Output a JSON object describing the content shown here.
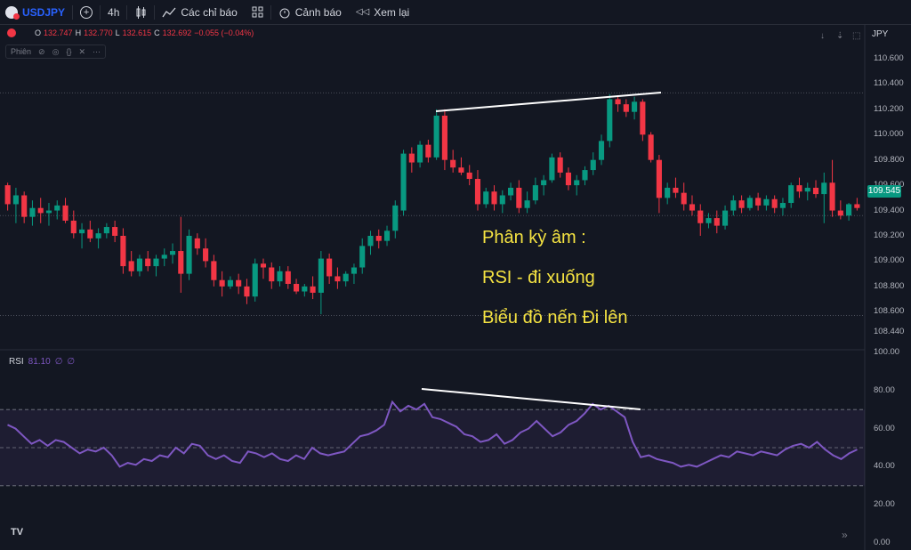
{
  "toolbar": {
    "symbol": "USDJPY",
    "add_icon": "+",
    "interval": "4h",
    "indicators_label": "Các chỉ báo",
    "alerts_label": "Cảnh báo",
    "replay_label": "Xem lại"
  },
  "legend": {
    "o_label": "O",
    "o": "132.747",
    "h_label": "H",
    "h": "132.770",
    "l_label": "L",
    "l": "132.615",
    "c_label": "C",
    "c": "132.692",
    "change": "−0.055 (−0.04%)",
    "session_label": "Phiên"
  },
  "rsi": {
    "name": "RSI",
    "value": "81.10",
    "p1": "∅",
    "p2": "∅"
  },
  "price_axis": {
    "currency": "JPY",
    "labels": [
      "110.600",
      "110.400",
      "110.200",
      "110.000",
      "109.800",
      "109.600",
      "109.400",
      "109.200",
      "109.000",
      "108.800",
      "108.600",
      "108.440"
    ],
    "current_price": "109.545"
  },
  "rsi_axis": {
    "labels": [
      "100.00",
      "80.00",
      "60.00",
      "40.00",
      "20.00",
      "0.00"
    ]
  },
  "annotations": {
    "line1": "Phân kỳ âm :",
    "line2": "RSI - đi xuống",
    "line3": "Biểu đồ nến Đi lên"
  },
  "branding": "TV",
  "colors": {
    "up": "#089981",
    "down": "#f23645",
    "rsi": "#7e57c2",
    "annotation": "#f5e342"
  },
  "chart_data": [
    {
      "type": "candlestick",
      "title": "USDJPY 4h",
      "ylim": [
        108.44,
        110.6
      ],
      "candles": [
        [
          109.6,
          109.62,
          109.4,
          109.45
        ],
        [
          109.45,
          109.58,
          109.3,
          109.52
        ],
        [
          109.52,
          109.55,
          109.3,
          109.35
        ],
        [
          109.35,
          109.48,
          109.28,
          109.42
        ],
        [
          109.42,
          109.5,
          109.3,
          109.38
        ],
        [
          109.38,
          109.46,
          109.28,
          109.4
        ],
        [
          109.4,
          109.48,
          109.33,
          109.44
        ],
        [
          109.44,
          109.5,
          109.3,
          109.32
        ],
        [
          109.32,
          109.4,
          109.18,
          109.22
        ],
        [
          109.22,
          109.3,
          109.1,
          109.25
        ],
        [
          109.25,
          109.32,
          109.15,
          109.18
        ],
        [
          109.18,
          109.26,
          109.1,
          109.22
        ],
        [
          109.22,
          109.3,
          109.18,
          109.27
        ],
        [
          109.27,
          109.32,
          109.15,
          109.2
        ],
        [
          109.2,
          109.26,
          108.9,
          108.96
        ],
        [
          109.0,
          109.08,
          108.88,
          108.92
        ],
        [
          108.92,
          109.05,
          108.88,
          109.02
        ],
        [
          109.02,
          109.08,
          108.92,
          108.96
        ],
        [
          108.96,
          109.05,
          108.88,
          109.02
        ],
        [
          109.02,
          109.1,
          108.96,
          109.05
        ],
        [
          109.05,
          109.14,
          108.98,
          109.08
        ],
        [
          109.08,
          109.35,
          108.75,
          108.9
        ],
        [
          108.9,
          109.25,
          108.85,
          109.2
        ],
        [
          109.18,
          109.22,
          109.05,
          109.1
        ],
        [
          109.1,
          109.18,
          108.95,
          109.0
        ],
        [
          109.0,
          109.05,
          108.8,
          108.85
        ],
        [
          108.85,
          108.92,
          108.72,
          108.8
        ],
        [
          108.8,
          108.88,
          108.78,
          108.85
        ],
        [
          108.85,
          108.9,
          108.74,
          108.8
        ],
        [
          108.8,
          108.86,
          108.66,
          108.72
        ],
        [
          108.72,
          109.02,
          108.68,
          108.98
        ],
        [
          108.98,
          109.02,
          108.86,
          108.95
        ],
        [
          108.95,
          108.99,
          108.78,
          108.84
        ],
        [
          108.84,
          108.96,
          108.8,
          108.92
        ],
        [
          108.92,
          108.96,
          108.78,
          108.82
        ],
        [
          108.82,
          108.86,
          108.74,
          108.76
        ],
        [
          108.76,
          108.82,
          108.72,
          108.8
        ],
        [
          108.8,
          108.88,
          108.7,
          108.75
        ],
        [
          108.75,
          109.08,
          108.58,
          109.02
        ],
        [
          109.02,
          109.06,
          108.82,
          108.88
        ],
        [
          108.88,
          108.95,
          108.78,
          108.84
        ],
        [
          108.84,
          108.92,
          108.8,
          108.9
        ],
        [
          108.9,
          108.98,
          108.82,
          108.95
        ],
        [
          108.95,
          109.18,
          108.9,
          109.12
        ],
        [
          109.12,
          109.24,
          109.05,
          109.2
        ],
        [
          109.2,
          109.25,
          109.1,
          109.16
        ],
        [
          109.16,
          109.28,
          109.12,
          109.24
        ],
        [
          109.24,
          109.48,
          109.18,
          109.44
        ],
        [
          109.4,
          109.88,
          109.36,
          109.85
        ],
        [
          109.85,
          109.9,
          109.7,
          109.78
        ],
        [
          109.78,
          109.95,
          109.74,
          109.92
        ],
        [
          109.92,
          109.96,
          109.78,
          109.82
        ],
        [
          109.82,
          110.2,
          109.8,
          110.15
        ],
        [
          110.15,
          110.2,
          109.72,
          109.8
        ],
        [
          109.8,
          109.88,
          109.7,
          109.74
        ],
        [
          109.74,
          109.82,
          109.68,
          109.7
        ],
        [
          109.7,
          109.76,
          109.6,
          109.65
        ],
        [
          109.65,
          109.72,
          109.4,
          109.45
        ],
        [
          109.45,
          109.58,
          109.42,
          109.55
        ],
        [
          109.55,
          109.6,
          109.4,
          109.45
        ],
        [
          109.45,
          109.56,
          109.38,
          109.52
        ],
        [
          109.52,
          109.62,
          109.48,
          109.58
        ],
        [
          109.58,
          109.64,
          109.38,
          109.42
        ],
        [
          109.42,
          109.55,
          109.38,
          109.48
        ],
        [
          109.48,
          109.66,
          109.45,
          109.6
        ],
        [
          109.6,
          109.68,
          109.52,
          109.64
        ],
        [
          109.64,
          109.85,
          109.62,
          109.82
        ],
        [
          109.82,
          109.86,
          109.66,
          109.7
        ],
        [
          109.7,
          109.74,
          109.56,
          109.6
        ],
        [
          109.6,
          109.68,
          109.52,
          109.64
        ],
        [
          109.64,
          109.75,
          109.6,
          109.72
        ],
        [
          109.72,
          109.86,
          109.68,
          109.8
        ],
        [
          109.8,
          110.0,
          109.76,
          109.95
        ],
        [
          109.95,
          110.32,
          109.9,
          110.28
        ],
        [
          110.28,
          110.31,
          110.18,
          110.24
        ],
        [
          110.24,
          110.28,
          110.14,
          110.18
        ],
        [
          110.18,
          110.3,
          110.12,
          110.26
        ],
        [
          110.26,
          110.28,
          109.95,
          110.0
        ],
        [
          110.0,
          110.02,
          109.78,
          109.8
        ],
        [
          109.8,
          109.84,
          109.38,
          109.5
        ],
        [
          109.5,
          109.62,
          109.45,
          109.58
        ],
        [
          109.58,
          109.66,
          109.5,
          109.54
        ],
        [
          109.54,
          109.62,
          109.4,
          109.45
        ],
        [
          109.45,
          109.52,
          109.36,
          109.4
        ],
        [
          109.4,
          109.45,
          109.2,
          109.3
        ],
        [
          109.3,
          109.38,
          109.26,
          109.34
        ],
        [
          109.34,
          109.4,
          109.22,
          109.28
        ],
        [
          109.28,
          109.44,
          109.25,
          109.4
        ],
        [
          109.4,
          109.52,
          109.36,
          109.48
        ],
        [
          109.48,
          109.52,
          109.38,
          109.42
        ],
        [
          109.42,
          109.52,
          109.4,
          109.5
        ],
        [
          109.5,
          109.54,
          109.4,
          109.44
        ],
        [
          109.44,
          109.52,
          109.4,
          109.49
        ],
        [
          109.49,
          109.52,
          109.38,
          109.42
        ],
        [
          109.42,
          109.5,
          109.36,
          109.46
        ],
        [
          109.46,
          109.62,
          109.42,
          109.6
        ],
        [
          109.6,
          109.66,
          109.5,
          109.55
        ],
        [
          109.55,
          109.62,
          109.48,
          109.58
        ],
        [
          109.58,
          109.64,
          109.5,
          109.53
        ],
        [
          109.53,
          109.7,
          109.3,
          109.62
        ],
        [
          109.62,
          109.8,
          109.35,
          109.4
        ],
        [
          109.4,
          109.48,
          109.33,
          109.36
        ],
        [
          109.36,
          109.46,
          109.32,
          109.45
        ],
        [
          109.45,
          109.5,
          109.4,
          109.42
        ]
      ]
    },
    {
      "type": "line",
      "title": "RSI",
      "ylim": [
        0,
        100
      ],
      "bands": [
        30,
        50,
        70
      ],
      "values": [
        62,
        60,
        56,
        52,
        54,
        51,
        54,
        53,
        50,
        47,
        49,
        48,
        50,
        46,
        40,
        42,
        41,
        44,
        43,
        46,
        45,
        50,
        47,
        52,
        51,
        46,
        44,
        46,
        43,
        42,
        48,
        47,
        45,
        47,
        44,
        43,
        46,
        44,
        50,
        47,
        46,
        47,
        48,
        52,
        56,
        57,
        59,
        62,
        74,
        69,
        72,
        70,
        73,
        66,
        65,
        63,
        61,
        57,
        56,
        53,
        54,
        57,
        52,
        54,
        58,
        60,
        64,
        60,
        56,
        58,
        62,
        64,
        68,
        73,
        70,
        72,
        69,
        66,
        53,
        45,
        46,
        44,
        43,
        42,
        40,
        41,
        40,
        42,
        44,
        46,
        45,
        48,
        47,
        46,
        48,
        47,
        46,
        49,
        51,
        52,
        50,
        53,
        49,
        46,
        44,
        47,
        49
      ]
    }
  ]
}
